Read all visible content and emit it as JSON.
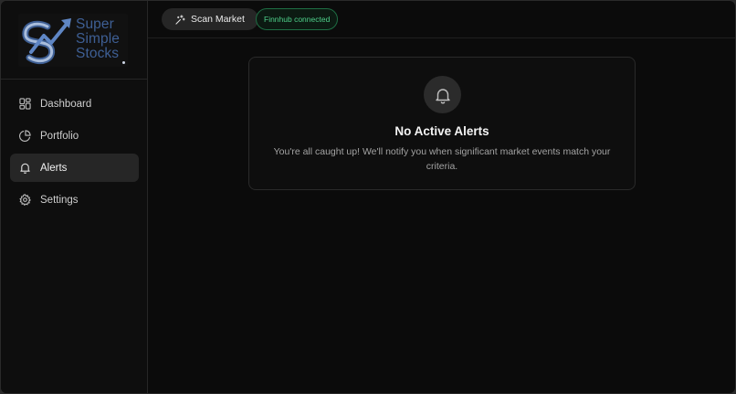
{
  "app": {
    "logo": {
      "line1": "Super",
      "line2": "Simple",
      "line3": "Stocks"
    }
  },
  "sidebar": {
    "items": [
      {
        "label": "Dashboard",
        "icon": "dashboard-grid-icon",
        "active": false
      },
      {
        "label": "Portfolio",
        "icon": "pie-chart-icon",
        "active": false
      },
      {
        "label": "Alerts",
        "icon": "bell-icon",
        "active": true
      },
      {
        "label": "Settings",
        "icon": "gear-icon",
        "active": false
      }
    ]
  },
  "topbar": {
    "scan_label": "Scan Market",
    "scan_icon": "sparkles-icon",
    "status_badge": "Finnhub connected",
    "status_color": "#4fd18b"
  },
  "empty_state": {
    "icon": "bell-icon",
    "title": "No Active Alerts",
    "description": "You're all caught up! We'll notify you when significant market events match your criteria."
  },
  "colors": {
    "background": "#0b0b0b",
    "active_nav": "#262626",
    "logo_blue": "#3e5f94"
  }
}
